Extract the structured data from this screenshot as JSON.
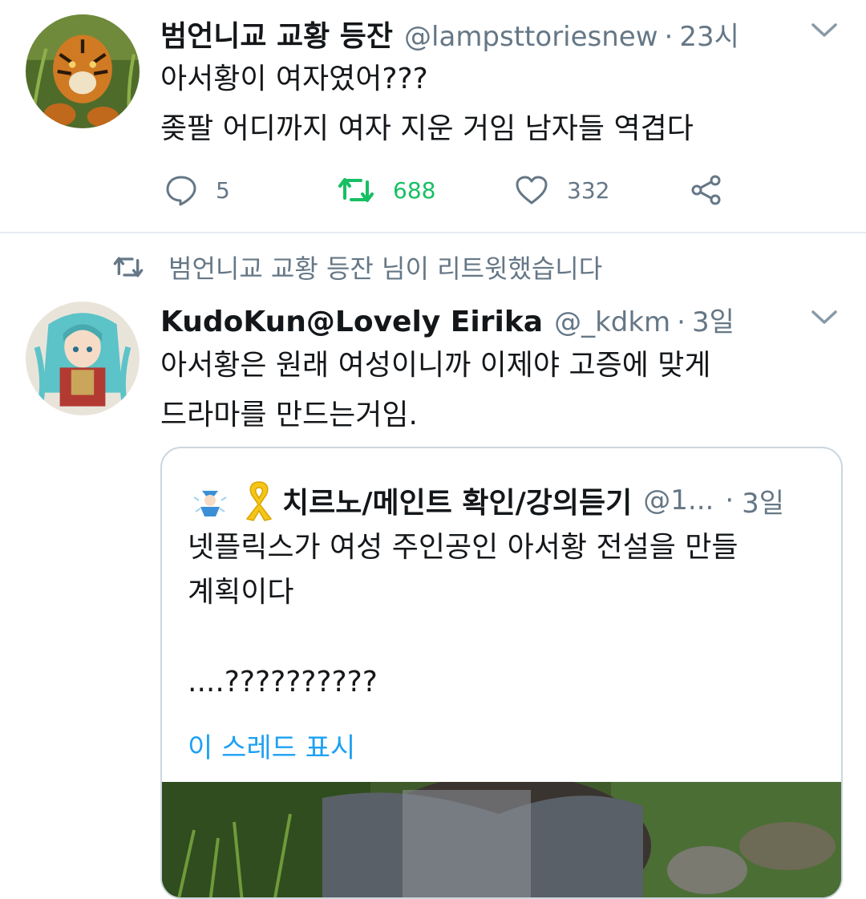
{
  "tweet1": {
    "name": "범언니교 교황 등잔",
    "handle": "@lampsttoriesnew",
    "dot": "·",
    "time": "23시",
    "text": "아서황이 여자였어???\n좆팔 어디까지 여자 지운 거임 남자들 역겹다",
    "actions": {
      "replies": "5",
      "retweets": "688",
      "likes": "332"
    },
    "icons": [
      "tiger-avatar",
      "chevron-down-icon",
      "reply-icon",
      "retweet-icon",
      "heart-icon",
      "share-icon"
    ]
  },
  "retweet_note": {
    "text": "범언니교 교황 등잔 님이 리트윗했습니다",
    "icon": "retweet-icon"
  },
  "tweet2": {
    "name": "KudoKun@Lovely Eirika",
    "handle": "@_kdkm",
    "dot": "·",
    "time": "3일",
    "text": "아서황은 원래 여성이니까 이제야 고증에 맞게\n드라마를 만드는거임.",
    "icons": [
      "anime-avatar",
      "chevron-down-icon"
    ]
  },
  "quote": {
    "emoji": "yellow-ribbon-icon",
    "name": "치르노/메인트 확인/강의듣기",
    "handle": "@1...",
    "dot": "·",
    "time": "3일",
    "text": "넷플릭스가  여성 주인공인 아서황 전설을 만들\n계획이다\n\n....??????????",
    "link": "이 스레드 표시"
  },
  "colors": {
    "text": "#14171a",
    "secondary": "#657786",
    "retweet_green": "#17bf63",
    "link_blue": "#1da1f2",
    "border": "#ccd6dd",
    "divider": "#e6ecf0",
    "ribbon_yellow": "#f5c518"
  }
}
